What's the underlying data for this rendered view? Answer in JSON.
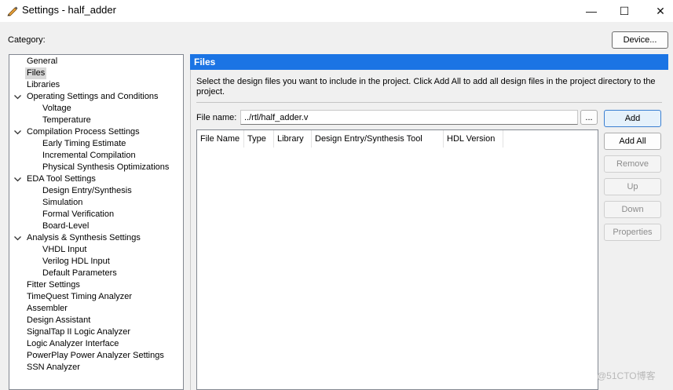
{
  "window": {
    "title": "Settings - half_adder",
    "controls": {
      "minimize": "—",
      "maximize": "☐",
      "close": "✕"
    }
  },
  "category_label": "Category:",
  "device_button": "Device...",
  "tree": [
    {
      "label": "General",
      "level": 1
    },
    {
      "label": "Files",
      "level": 1,
      "selected": true
    },
    {
      "label": "Libraries",
      "level": 1
    },
    {
      "label": "Operating Settings and Conditions",
      "level": 1,
      "expanded": true
    },
    {
      "label": "Voltage",
      "level": 2
    },
    {
      "label": "Temperature",
      "level": 2
    },
    {
      "label": "Compilation Process Settings",
      "level": 1,
      "expanded": true
    },
    {
      "label": "Early Timing Estimate",
      "level": 2
    },
    {
      "label": "Incremental Compilation",
      "level": 2
    },
    {
      "label": "Physical Synthesis Optimizations",
      "level": 2
    },
    {
      "label": "EDA Tool Settings",
      "level": 1,
      "expanded": true
    },
    {
      "label": "Design Entry/Synthesis",
      "level": 2
    },
    {
      "label": "Simulation",
      "level": 2
    },
    {
      "label": "Formal Verification",
      "level": 2
    },
    {
      "label": "Board-Level",
      "level": 2
    },
    {
      "label": "Analysis & Synthesis Settings",
      "level": 1,
      "expanded": true
    },
    {
      "label": "VHDL Input",
      "level": 2
    },
    {
      "label": "Verilog HDL Input",
      "level": 2
    },
    {
      "label": "Default Parameters",
      "level": 2
    },
    {
      "label": "Fitter Settings",
      "level": 1
    },
    {
      "label": "TimeQuest Timing Analyzer",
      "level": 1
    },
    {
      "label": "Assembler",
      "level": 1
    },
    {
      "label": "Design Assistant",
      "level": 1
    },
    {
      "label": "SignalTap II Logic Analyzer",
      "level": 1
    },
    {
      "label": "Logic Analyzer Interface",
      "level": 1
    },
    {
      "label": "PowerPlay Power Analyzer Settings",
      "level": 1
    },
    {
      "label": "SSN Analyzer",
      "level": 1
    }
  ],
  "panel": {
    "title": "Files",
    "description": "Select the design files you want to include in the project. Click Add All to add all design files in the project directory to the project.",
    "file_name_label": "File name:",
    "file_name_value": "../rtl/half_adder.v",
    "browse_label": "...",
    "columns": [
      "File Name",
      "Type",
      "Library",
      "Design Entry/Synthesis Tool",
      "HDL Version"
    ],
    "buttons": {
      "add": "Add",
      "add_all": "Add All",
      "remove": "Remove",
      "up": "Up",
      "down": "Down",
      "properties": "Properties"
    }
  },
  "watermark": "@51CTO博客"
}
